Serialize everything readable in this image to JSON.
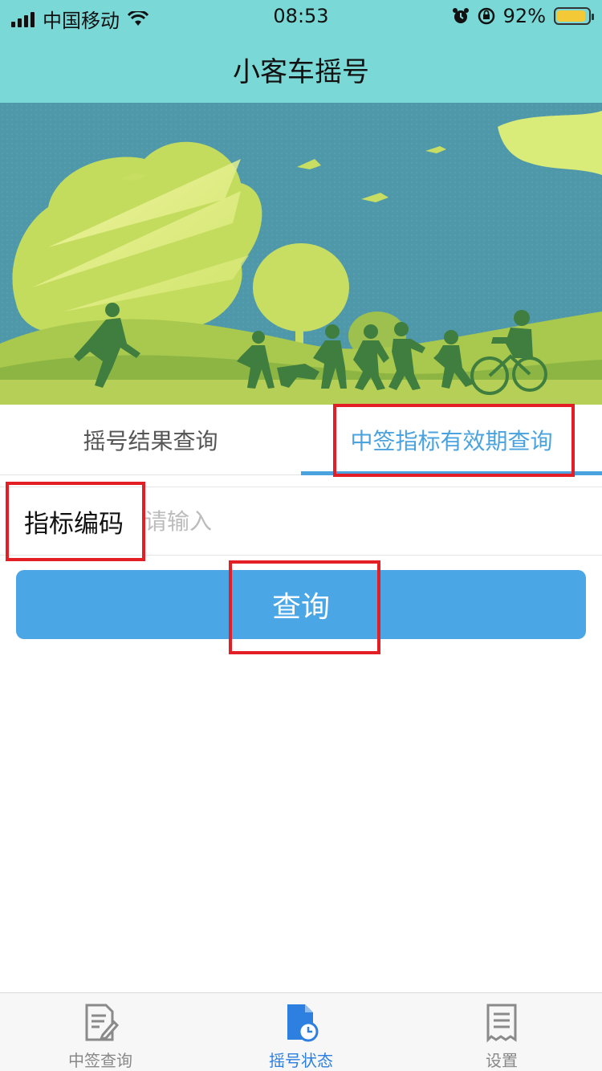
{
  "status_bar": {
    "carrier": "中国移动",
    "time": "08:53",
    "battery": "92%",
    "battery_level": 0.92
  },
  "nav": {
    "title": "小客车摇号"
  },
  "tabs": [
    {
      "label": "摇号结果查询",
      "active": false
    },
    {
      "label": "中签指标有效期查询",
      "active": true
    }
  ],
  "form": {
    "label": "指标编码",
    "placeholder": "请输入",
    "value": ""
  },
  "query_button": {
    "label": "查询"
  },
  "tabbar": [
    {
      "label": "中签查询",
      "icon": "document-edit-icon",
      "active": false
    },
    {
      "label": "摇号状态",
      "icon": "document-clock-icon",
      "active": true
    },
    {
      "label": "设置",
      "icon": "receipt-list-icon",
      "active": false
    }
  ],
  "colors": {
    "nav_bg": "#7ad8d6",
    "accent": "#4aa3de",
    "button_bg": "#4aa6e5",
    "annotation": "#e31e24",
    "tabbar_active": "#2d7fe0"
  }
}
